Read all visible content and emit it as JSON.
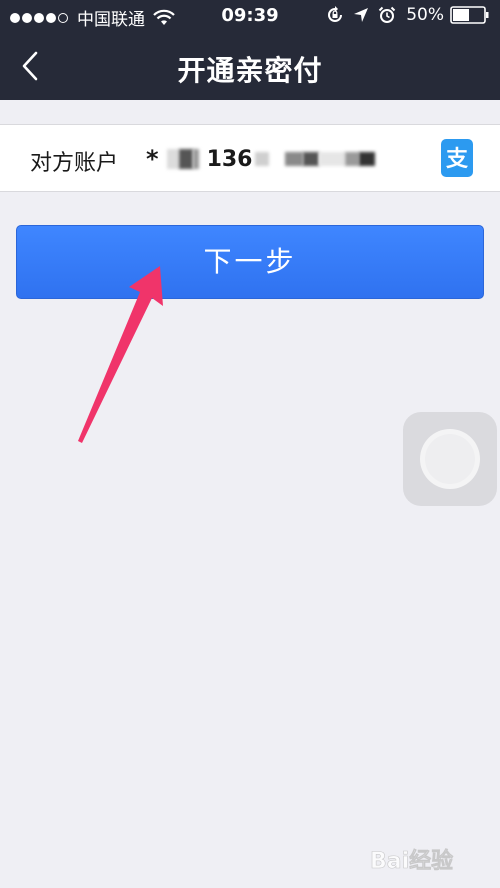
{
  "status_bar": {
    "carrier": "中国联通",
    "time": "09:39",
    "battery": "50%",
    "icons": [
      "signal-dots",
      "wifi-icon",
      "rotation-lock-icon",
      "location-arrow-icon",
      "alarm-icon",
      "battery-icon"
    ]
  },
  "nav": {
    "title": "开通亲密付",
    "back_icon": "chevron-left-icon"
  },
  "account": {
    "label": "对方账户",
    "prefix": "*",
    "number_visible": "136",
    "icon": "alipay-icon",
    "icon_text": "支"
  },
  "next_button": {
    "label": "下一步"
  },
  "watermark": {
    "text": "Bai经验"
  },
  "colors": {
    "nav_bg": "#262a38",
    "page_bg": "#efeff4",
    "button_blue": "#3f86ff",
    "alipay_blue": "#2c9af0",
    "arrow_pink": "#f0346a"
  }
}
